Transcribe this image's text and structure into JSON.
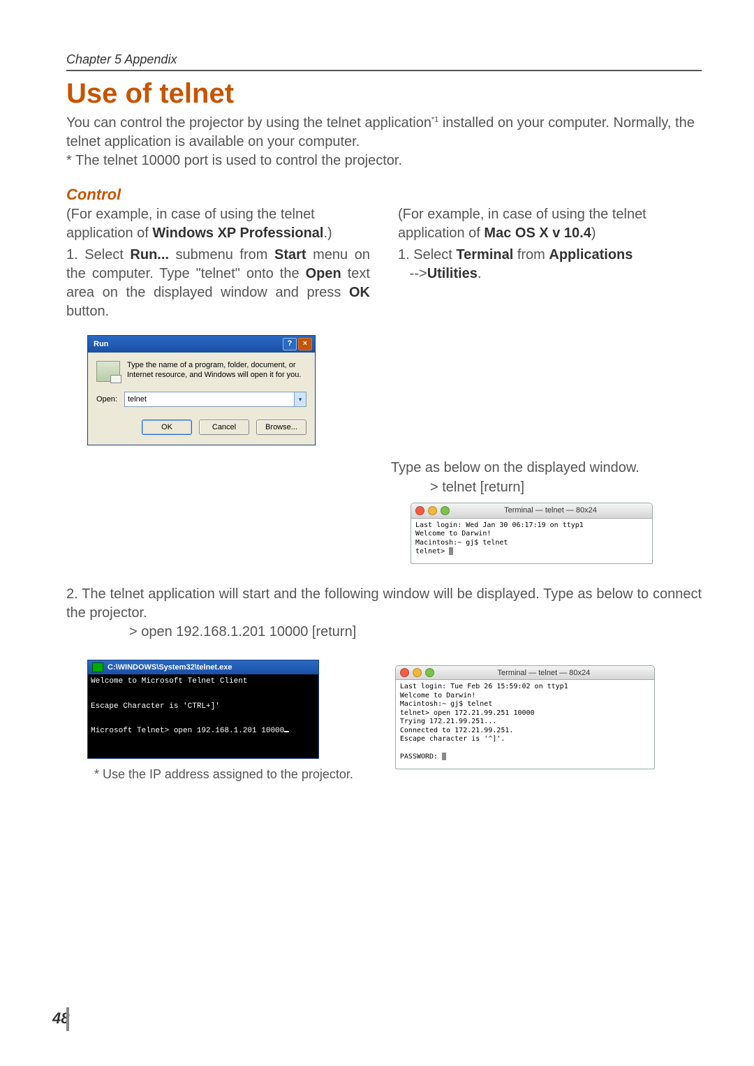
{
  "header": {
    "chapter": "Chapter 5 Appendix"
  },
  "title": "Use of telnet",
  "intro": {
    "line1a": "You can control the projector by using the telnet application",
    "sup": "*1",
    "line1b": " installed on your computer. Normally, the telnet application is available on your computer.",
    "line2": "* The telnet 10000 port is used to control the projector."
  },
  "control_heading": "Control",
  "left": {
    "context_a": "(For example, in case of using the telnet application of ",
    "context_bold": "Windows XP Professional",
    "context_b": ".)",
    "step1_pre": "1. Select ",
    "run": "Run...",
    "mid1": " submenu from ",
    "start": "Start",
    "mid2": " menu on the computer. Type \"telnet\" onto the ",
    "open": "Open",
    "mid3": " text area on the displayed window and press ",
    "ok": "OK",
    "mid4": " button."
  },
  "right": {
    "context_a": "(For example, in case of using the telnet application of ",
    "context_bold": "Mac OS X v 10.4",
    "context_b": ")",
    "step1_pre": "1. Select ",
    "terminal": "Terminal",
    "mid1": " from ",
    "apps": "Applications",
    "arrow": " -->",
    "utilities": "Utilities",
    "end": "."
  },
  "run_dialog": {
    "title": "Run",
    "help": "?",
    "close": "×",
    "message": "Type the name of a program, folder, document, or Internet resource, and Windows will open it for you.",
    "open_label": "Open:",
    "input_value": "telnet",
    "btn_ok": "OK",
    "btn_cancel": "Cancel",
    "btn_browse": "Browse..."
  },
  "typed": {
    "line1": "Type  as below on the displayed window.",
    "line2": "> telnet [return]"
  },
  "mac1": {
    "title": "Terminal — telnet — 80x24",
    "body": "Last login: Wed Jan 30 06:17:19 on ttyp1\nWelcome to Darwin!\nMacintosh:~ gj$ telnet\ntelnet> "
  },
  "step2": {
    "text": "2. The telnet application will start and the following window will be displayed. Type as below to connect the projector.",
    "cmd": "> open 192.168.1.201 10000 [return]"
  },
  "cmd_win": {
    "title": "C:\\WINDOWS\\System32\\telnet.exe",
    "body": "Welcome to Microsoft Telnet Client\n\nEscape Character is 'CTRL+]'\n\nMicrosoft Telnet> open 192.168.1.201 10000"
  },
  "mac2": {
    "title": "Terminal — telnet — 80x24",
    "body": "Last login: Tue Feb 26 15:59:02 on ttyp1\nWelcome to Darwin!\nMacintosh:~ gj$ telnet\ntelnet> open 172.21.99.251 10000\nTrying 172.21.99.251...\nConnected to 172.21.99.251.\nEscape character is '^]'.\n\nPASSWORD: "
  },
  "ip_note": "* Use the IP address assigned to the projector.",
  "page_number": "48"
}
